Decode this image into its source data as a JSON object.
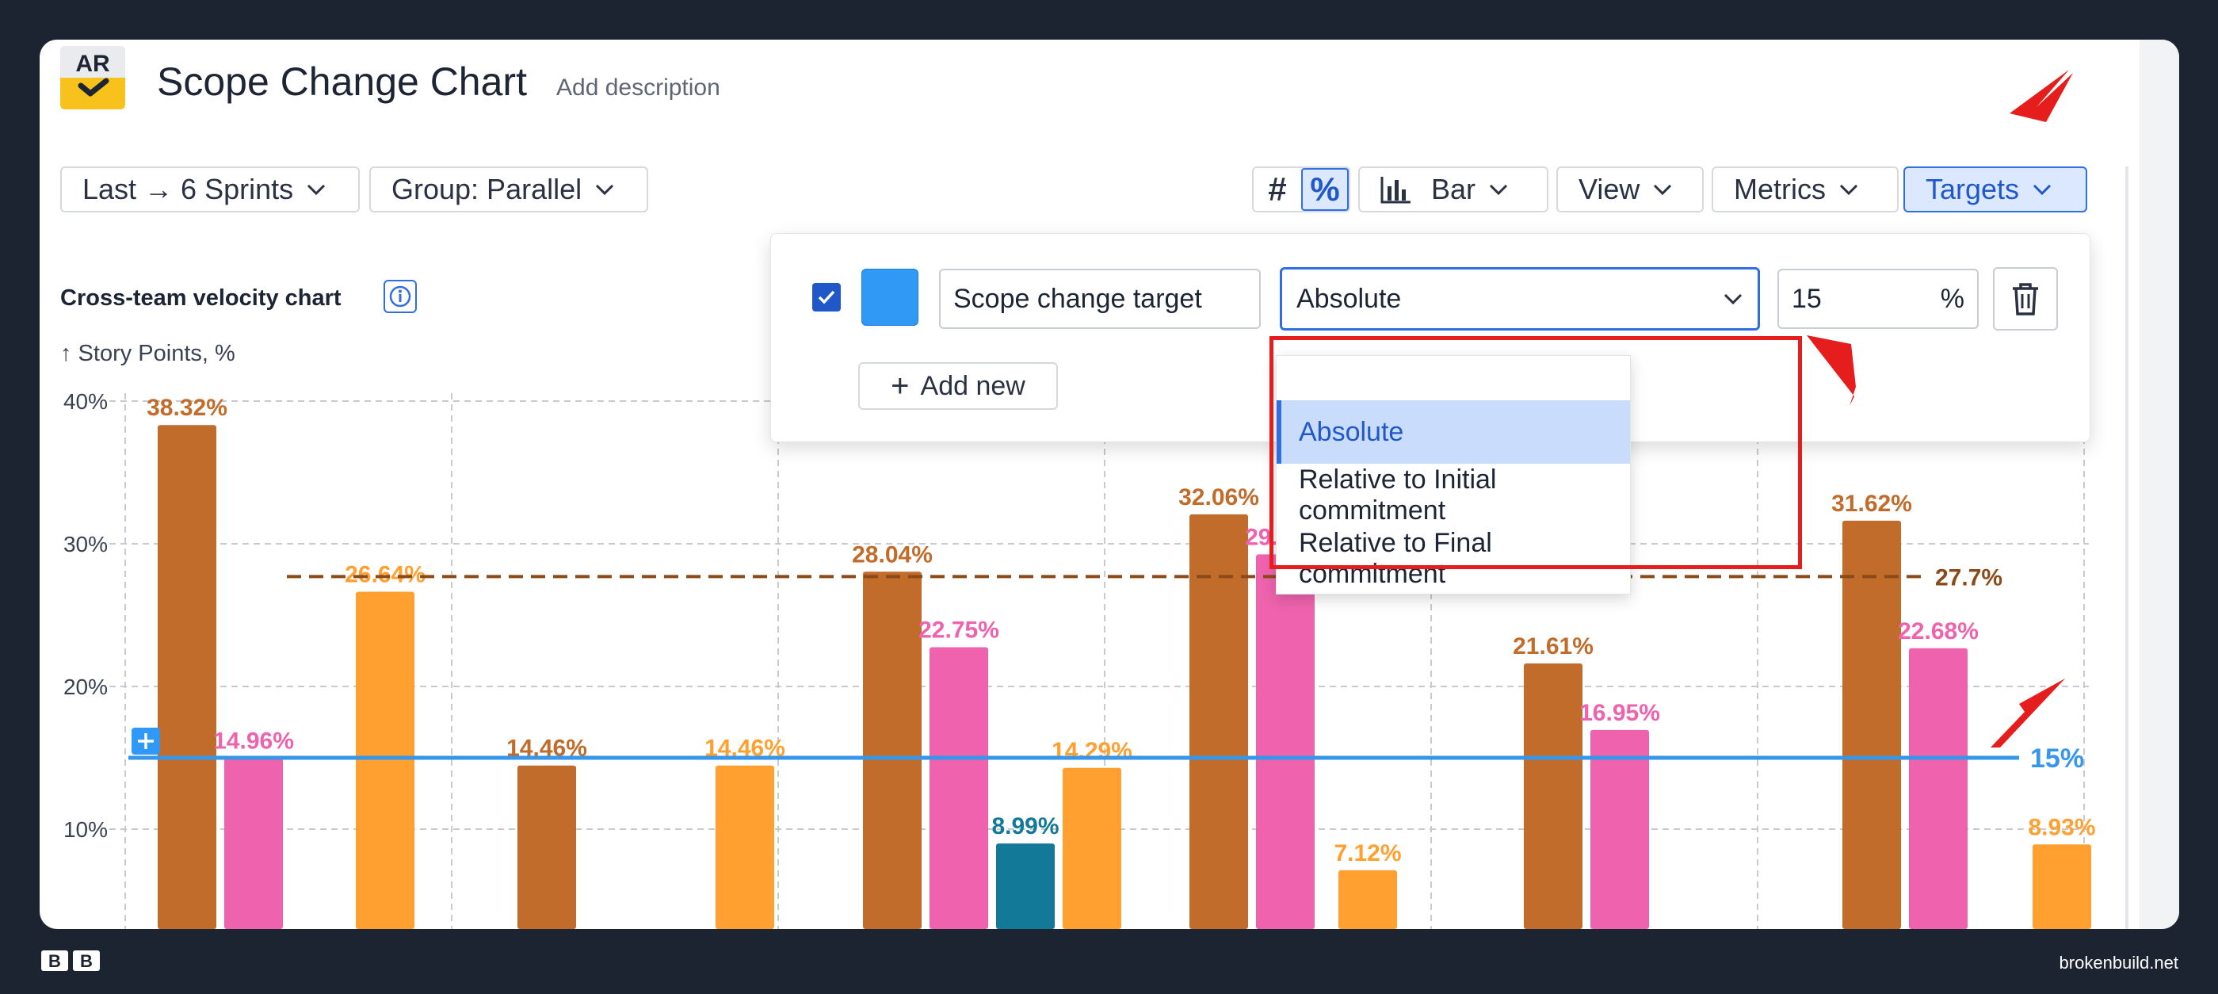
{
  "header": {
    "logo_text": "AR",
    "title": "Scope Change Chart",
    "description_placeholder": "Add description"
  },
  "toolbar": {
    "range_label": "Last → 6 Sprints",
    "group_label": "Group: Parallel",
    "count_toggle": "#",
    "percent_toggle": "%",
    "chart_type_label": "Bar",
    "view_label": "View",
    "metrics_label": "Metrics",
    "targets_label": "Targets"
  },
  "chart_header": {
    "title": "Cross-team velocity chart",
    "y_unit": "↑ Story Points, %"
  },
  "targets_panel": {
    "enabled": true,
    "color": "#2f99f5",
    "name_value": "Scope change target",
    "type_value": "Absolute",
    "target_value": "15",
    "unit": "%",
    "add_new_label": "Add new"
  },
  "type_dropdown": {
    "options": [
      "Absolute",
      "Relative to Initial commitment",
      "Relative to Final commitment"
    ],
    "selected": "Absolute"
  },
  "colors": {
    "brown": "#c26c2b",
    "pink": "#ef63ae",
    "orange": "#ffa030",
    "teal": "#127a98",
    "target_line": "#3596ea",
    "avg_line": "#8b4a18",
    "annotation_red": "#e61d1d"
  },
  "chart_data": {
    "type": "bar",
    "y_ticks": [
      "40%",
      "30%",
      "20%",
      "10%"
    ],
    "ylim": [
      0,
      40
    ],
    "grid": true,
    "bars": [
      {
        "value": 38.32,
        "label": "38.32%",
        "color": "brown"
      },
      {
        "value": 14.96,
        "label": "14.96%",
        "color": "pink"
      },
      {
        "value": 26.64,
        "label": "26.64%",
        "color": "orange"
      },
      {
        "value": 14.46,
        "label": "14.46%",
        "color": "brown"
      },
      {
        "value": 14.46,
        "label": "14.46%",
        "color": "orange"
      },
      {
        "value": 28.04,
        "label": "28.04%",
        "color": "brown"
      },
      {
        "value": 22.75,
        "label": "22.75%",
        "color": "pink"
      },
      {
        "value": 8.99,
        "label": "8.99%",
        "color": "teal"
      },
      {
        "value": 14.29,
        "label": "14.29%",
        "color": "orange"
      },
      {
        "value": 32.06,
        "label": "32.06%",
        "color": "brown"
      },
      {
        "value": 29.26,
        "label": "29.26%",
        "color": "pink"
      },
      {
        "value": 7.12,
        "label": "7.12%",
        "color": "orange"
      },
      {
        "value": 21.61,
        "label": "21.61%",
        "color": "brown"
      },
      {
        "value": 16.95,
        "label": "16.95%",
        "color": "pink"
      },
      {
        "value": 31.62,
        "label": "31.62%",
        "color": "brown"
      },
      {
        "value": 22.68,
        "label": "22.68%",
        "color": "pink"
      },
      {
        "value": 8.93,
        "label": "8.93%",
        "color": "orange"
      }
    ],
    "average_line": {
      "value": 27.7,
      "label": "27.7%"
    },
    "target_line": {
      "value": 15,
      "label": "15%"
    }
  },
  "footer": {
    "logo": "BB",
    "site": "brokenbuild.net"
  }
}
